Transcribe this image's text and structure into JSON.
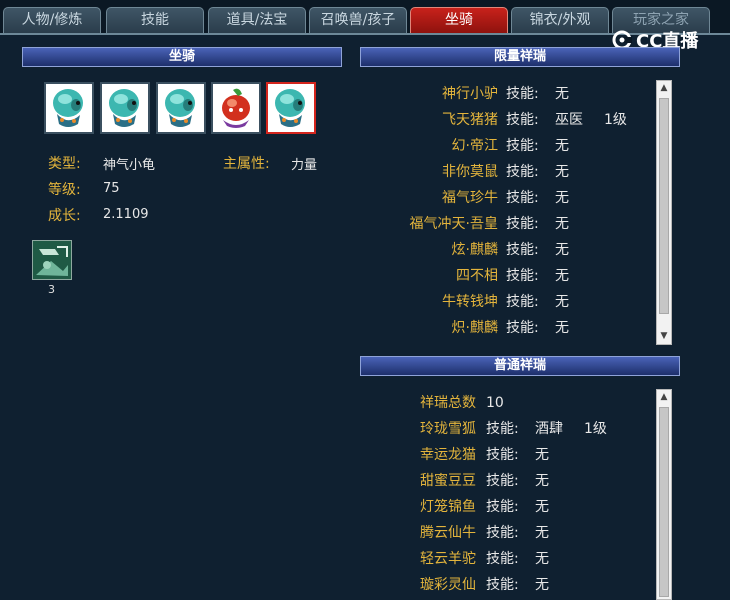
{
  "tabs": [
    {
      "label": "人物/修炼"
    },
    {
      "label": "技能"
    },
    {
      "label": "道具/法宝"
    },
    {
      "label": "召唤兽/孩子"
    },
    {
      "label": "坐骑",
      "active": true
    },
    {
      "label": "锦衣/外观"
    },
    {
      "label": "玩家之家"
    }
  ],
  "watermark": {
    "text": "CC直播"
  },
  "mount_panel": {
    "title": "坐骑",
    "slots": [
      {
        "icon": "mount-turtle-icon",
        "selected": false
      },
      {
        "icon": "mount-turtle-icon",
        "selected": false
      },
      {
        "icon": "mount-turtle-icon",
        "selected": false
      },
      {
        "icon": "mount-red-creature-icon",
        "selected": false
      },
      {
        "icon": "mount-turtle-icon",
        "selected": true
      }
    ],
    "type_label": "类型:",
    "type_value": "神气小龟",
    "attr_label": "主属性:",
    "attr_value": "力量",
    "level_label": "等级:",
    "level_value": "75",
    "growth_label": "成长:",
    "growth_value": "2.1109",
    "skill_count": "3"
  },
  "limited": {
    "title": "限量祥瑞",
    "rows": [
      {
        "name": "神行小驴",
        "key": "技能:",
        "value": "无",
        "level": ""
      },
      {
        "name": "飞天猪猪",
        "key": "技能:",
        "value": "巫医",
        "level": "1级"
      },
      {
        "name": "幻·帝江",
        "key": "技能:",
        "value": "无",
        "level": ""
      },
      {
        "name": "非你莫鼠",
        "key": "技能:",
        "value": "无",
        "level": ""
      },
      {
        "name": "福气珍牛",
        "key": "技能:",
        "value": "无",
        "level": ""
      },
      {
        "name": "福气冲天·吾皇",
        "key": "技能:",
        "value": "无",
        "level": ""
      },
      {
        "name": "炫·麒麟",
        "key": "技能:",
        "value": "无",
        "level": ""
      },
      {
        "name": "四不相",
        "key": "技能:",
        "value": "无",
        "level": ""
      },
      {
        "name": "牛转钱坤",
        "key": "技能:",
        "value": "无",
        "level": ""
      },
      {
        "name": "炽·麒麟",
        "key": "技能:",
        "value": "无",
        "level": ""
      }
    ]
  },
  "normal": {
    "title": "普通祥瑞",
    "total_label": "祥瑞总数",
    "total_value": "10",
    "rows": [
      {
        "name": "玲珑雪狐",
        "key": "技能:",
        "value": "酒肆",
        "level": "1级"
      },
      {
        "name": "幸运龙猫",
        "key": "技能:",
        "value": "无",
        "level": ""
      },
      {
        "name": "甜蜜豆豆",
        "key": "技能:",
        "value": "无",
        "level": ""
      },
      {
        "name": "灯笼锦鱼",
        "key": "技能:",
        "value": "无",
        "level": ""
      },
      {
        "name": "腾云仙牛",
        "key": "技能:",
        "value": "无",
        "level": ""
      },
      {
        "name": "轻云羊驼",
        "key": "技能:",
        "value": "无",
        "level": ""
      },
      {
        "name": "璇彩灵仙",
        "key": "技能:",
        "value": "无",
        "level": ""
      }
    ]
  }
}
